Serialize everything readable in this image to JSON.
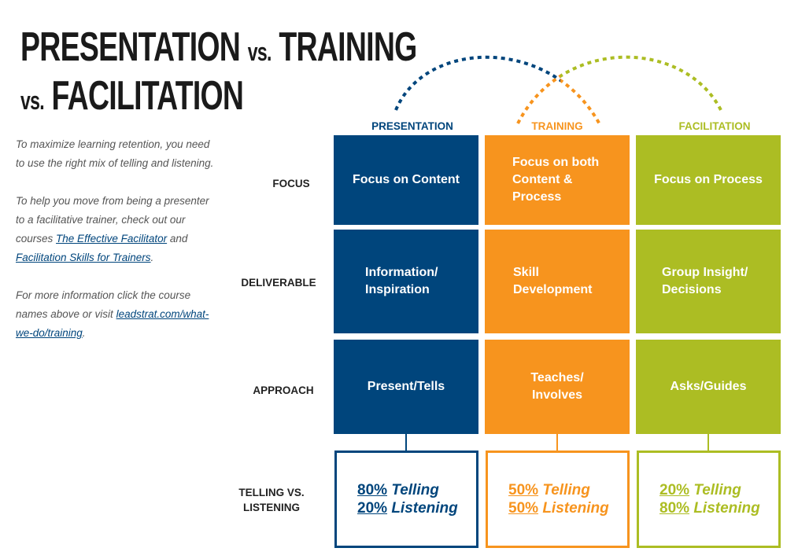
{
  "title": {
    "w1": "PRESENTATION",
    "vs1": "vs.",
    "w2": "TRAINING",
    "vs2": "vs.",
    "w3": "FACILITATION"
  },
  "intro": {
    "p1": "To maximize learning retention, you need to use the right mix of telling and listening.",
    "p2_pre": "To help you move from being a presenter to a facilitative trainer, check out our courses",
    "link1": "The Effective Facilitator",
    "and": "and",
    "link2": "Facilitation Skills for Trainers",
    "period": ".",
    "p3_pre": "For more information click the course names above or visit",
    "link3": "leadstrat.com/what-we-do/training",
    "period2": "."
  },
  "colors": {
    "presentation": "#00457c",
    "training": "#f7941e",
    "facilitation": "#acbd23"
  },
  "columns": [
    "PRESENTATION",
    "TRAINING",
    "FACILITATION"
  ],
  "rows": [
    "FOCUS",
    "DELIVERABLE",
    "APPROACH",
    "TELLING VS. LISTENING"
  ],
  "cells": {
    "focus": [
      "Focus on Content",
      "Focus on both Content & Process",
      "Focus on Process"
    ],
    "deliverable": [
      "Information/ Inspiration",
      "Skill Development",
      "Group Insight/ Decisions"
    ],
    "approach": [
      "Present/Tells",
      "Teaches/ Involves",
      "Asks/Guides"
    ]
  },
  "ratios": [
    {
      "tell_pct": "80%",
      "tell": "Telling",
      "listen_pct": "20%",
      "listen": "Listening"
    },
    {
      "tell_pct": "50%",
      "tell": "Telling",
      "listen_pct": "50%",
      "listen": "Listening"
    },
    {
      "tell_pct": "20%",
      "tell": "Telling",
      "listen_pct": "80%",
      "listen": "Listening"
    }
  ]
}
